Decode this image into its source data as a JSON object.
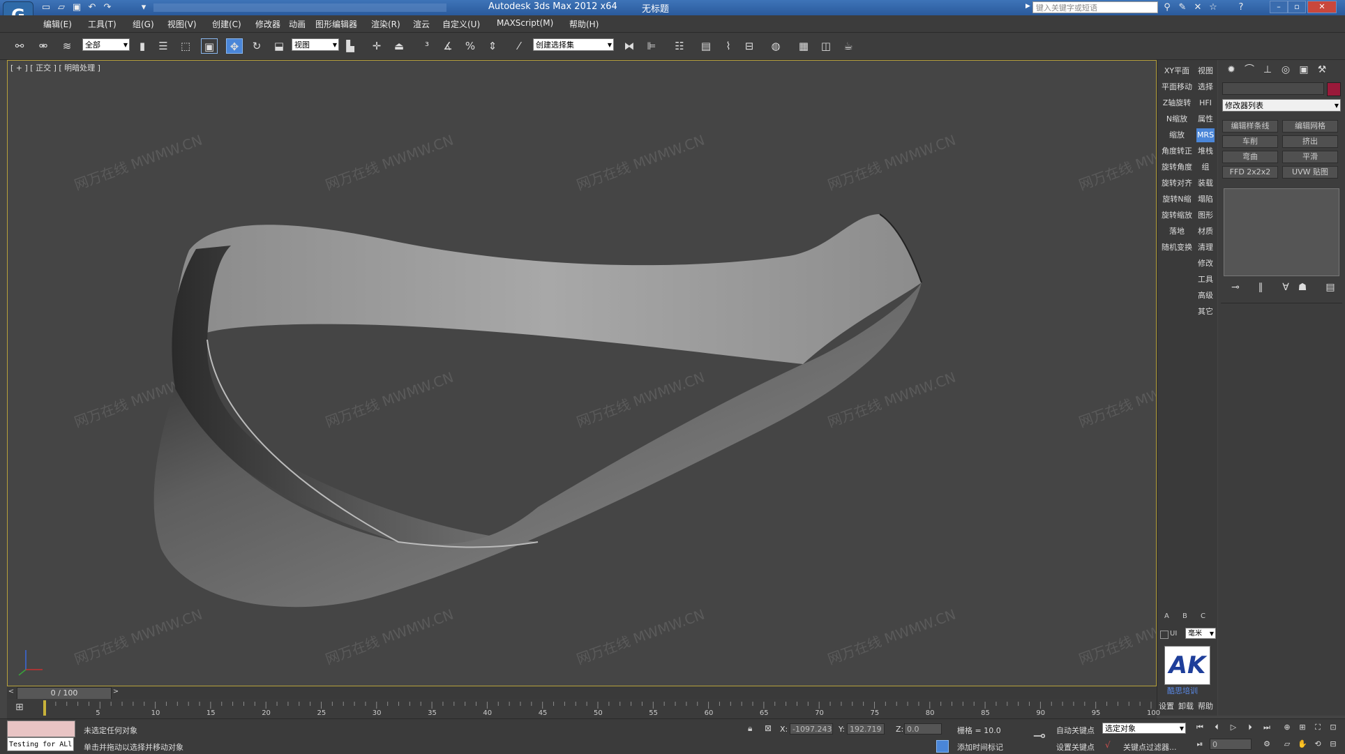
{
  "titlebar": {
    "app_title": "Autodesk 3ds Max  2012 x64",
    "doc_title": "无标题",
    "search_placeholder": "键入关键字或短语"
  },
  "menu": [
    "编辑(E)",
    "工具(T)",
    "组(G)",
    "视图(V)",
    "创建(C)",
    "修改器",
    "动画",
    "图形编辑器",
    "渲染(R)",
    "渲云",
    "自定义(U)",
    "MAXScript(M)",
    "帮助(H)"
  ],
  "toolbar": {
    "selection_filter": "全部",
    "ref_coord": "视图",
    "named_selection": "创建选择集"
  },
  "viewport": {
    "label": "[ + ] [ 正交 ] [ 明暗处理 ]",
    "watermark": "MWMW.CN",
    "watermark_cn": "网万在线"
  },
  "cmd_strip": {
    "left": [
      "XY平面",
      "平面移动",
      "Z轴旋转",
      "N缩放",
      "缩放",
      "角度转正",
      "旋转角度",
      "旋转对齐",
      "旋转N缩",
      "旋转缩放",
      "落地",
      "随机变换"
    ],
    "right": [
      "视图",
      "选择",
      "HFI",
      "属性",
      "MRS",
      "堆栈",
      "组",
      "装载",
      "塌陷",
      "图形",
      "材质",
      "清理",
      "修改",
      "工具",
      "高级",
      "其它"
    ],
    "abc": [
      "A",
      "B",
      "C"
    ],
    "unit_checkbox": "UI",
    "unit": "毫米",
    "logo_text": "AK",
    "logo_caption": "酷思培训",
    "bottom": [
      "设置",
      "卸载",
      "帮助"
    ]
  },
  "cmd_panel": {
    "modifier_list": "修改器列表",
    "buttons": [
      "编辑样条线",
      "编辑网格",
      "车削",
      "挤出",
      "弯曲",
      "平滑",
      "FFD 2x2x2",
      "UVW 贴图"
    ]
  },
  "timeline": {
    "frame": "0 / 100",
    "ticks": [
      "5",
      "10",
      "15",
      "20",
      "25",
      "30",
      "35",
      "40",
      "45",
      "50",
      "55",
      "60",
      "65",
      "70",
      "75",
      "80",
      "85",
      "90",
      "95",
      "100"
    ]
  },
  "status": {
    "maxscript": "Testing for ALl",
    "line1": "未选定任何对象",
    "line2": "单击并拖动以选择并移动对象",
    "x_label": "X:",
    "x": "-1097.243",
    "y_label": "Y:",
    "y": "192.719",
    "z_label": "Z:",
    "z": "0.0",
    "grid": "栅格 = 10.0",
    "add_time_tag": "添加时间标记",
    "auto_key": "自动关键点",
    "set_key": "设置关键点",
    "selected": "选定对象",
    "key_filters": "关键点过滤器...",
    "frame_field": "0"
  },
  "colors": {
    "accent": "#4a86d8",
    "viewport_border": "#b8a23c",
    "color_swatch": "#9a1a3a"
  }
}
